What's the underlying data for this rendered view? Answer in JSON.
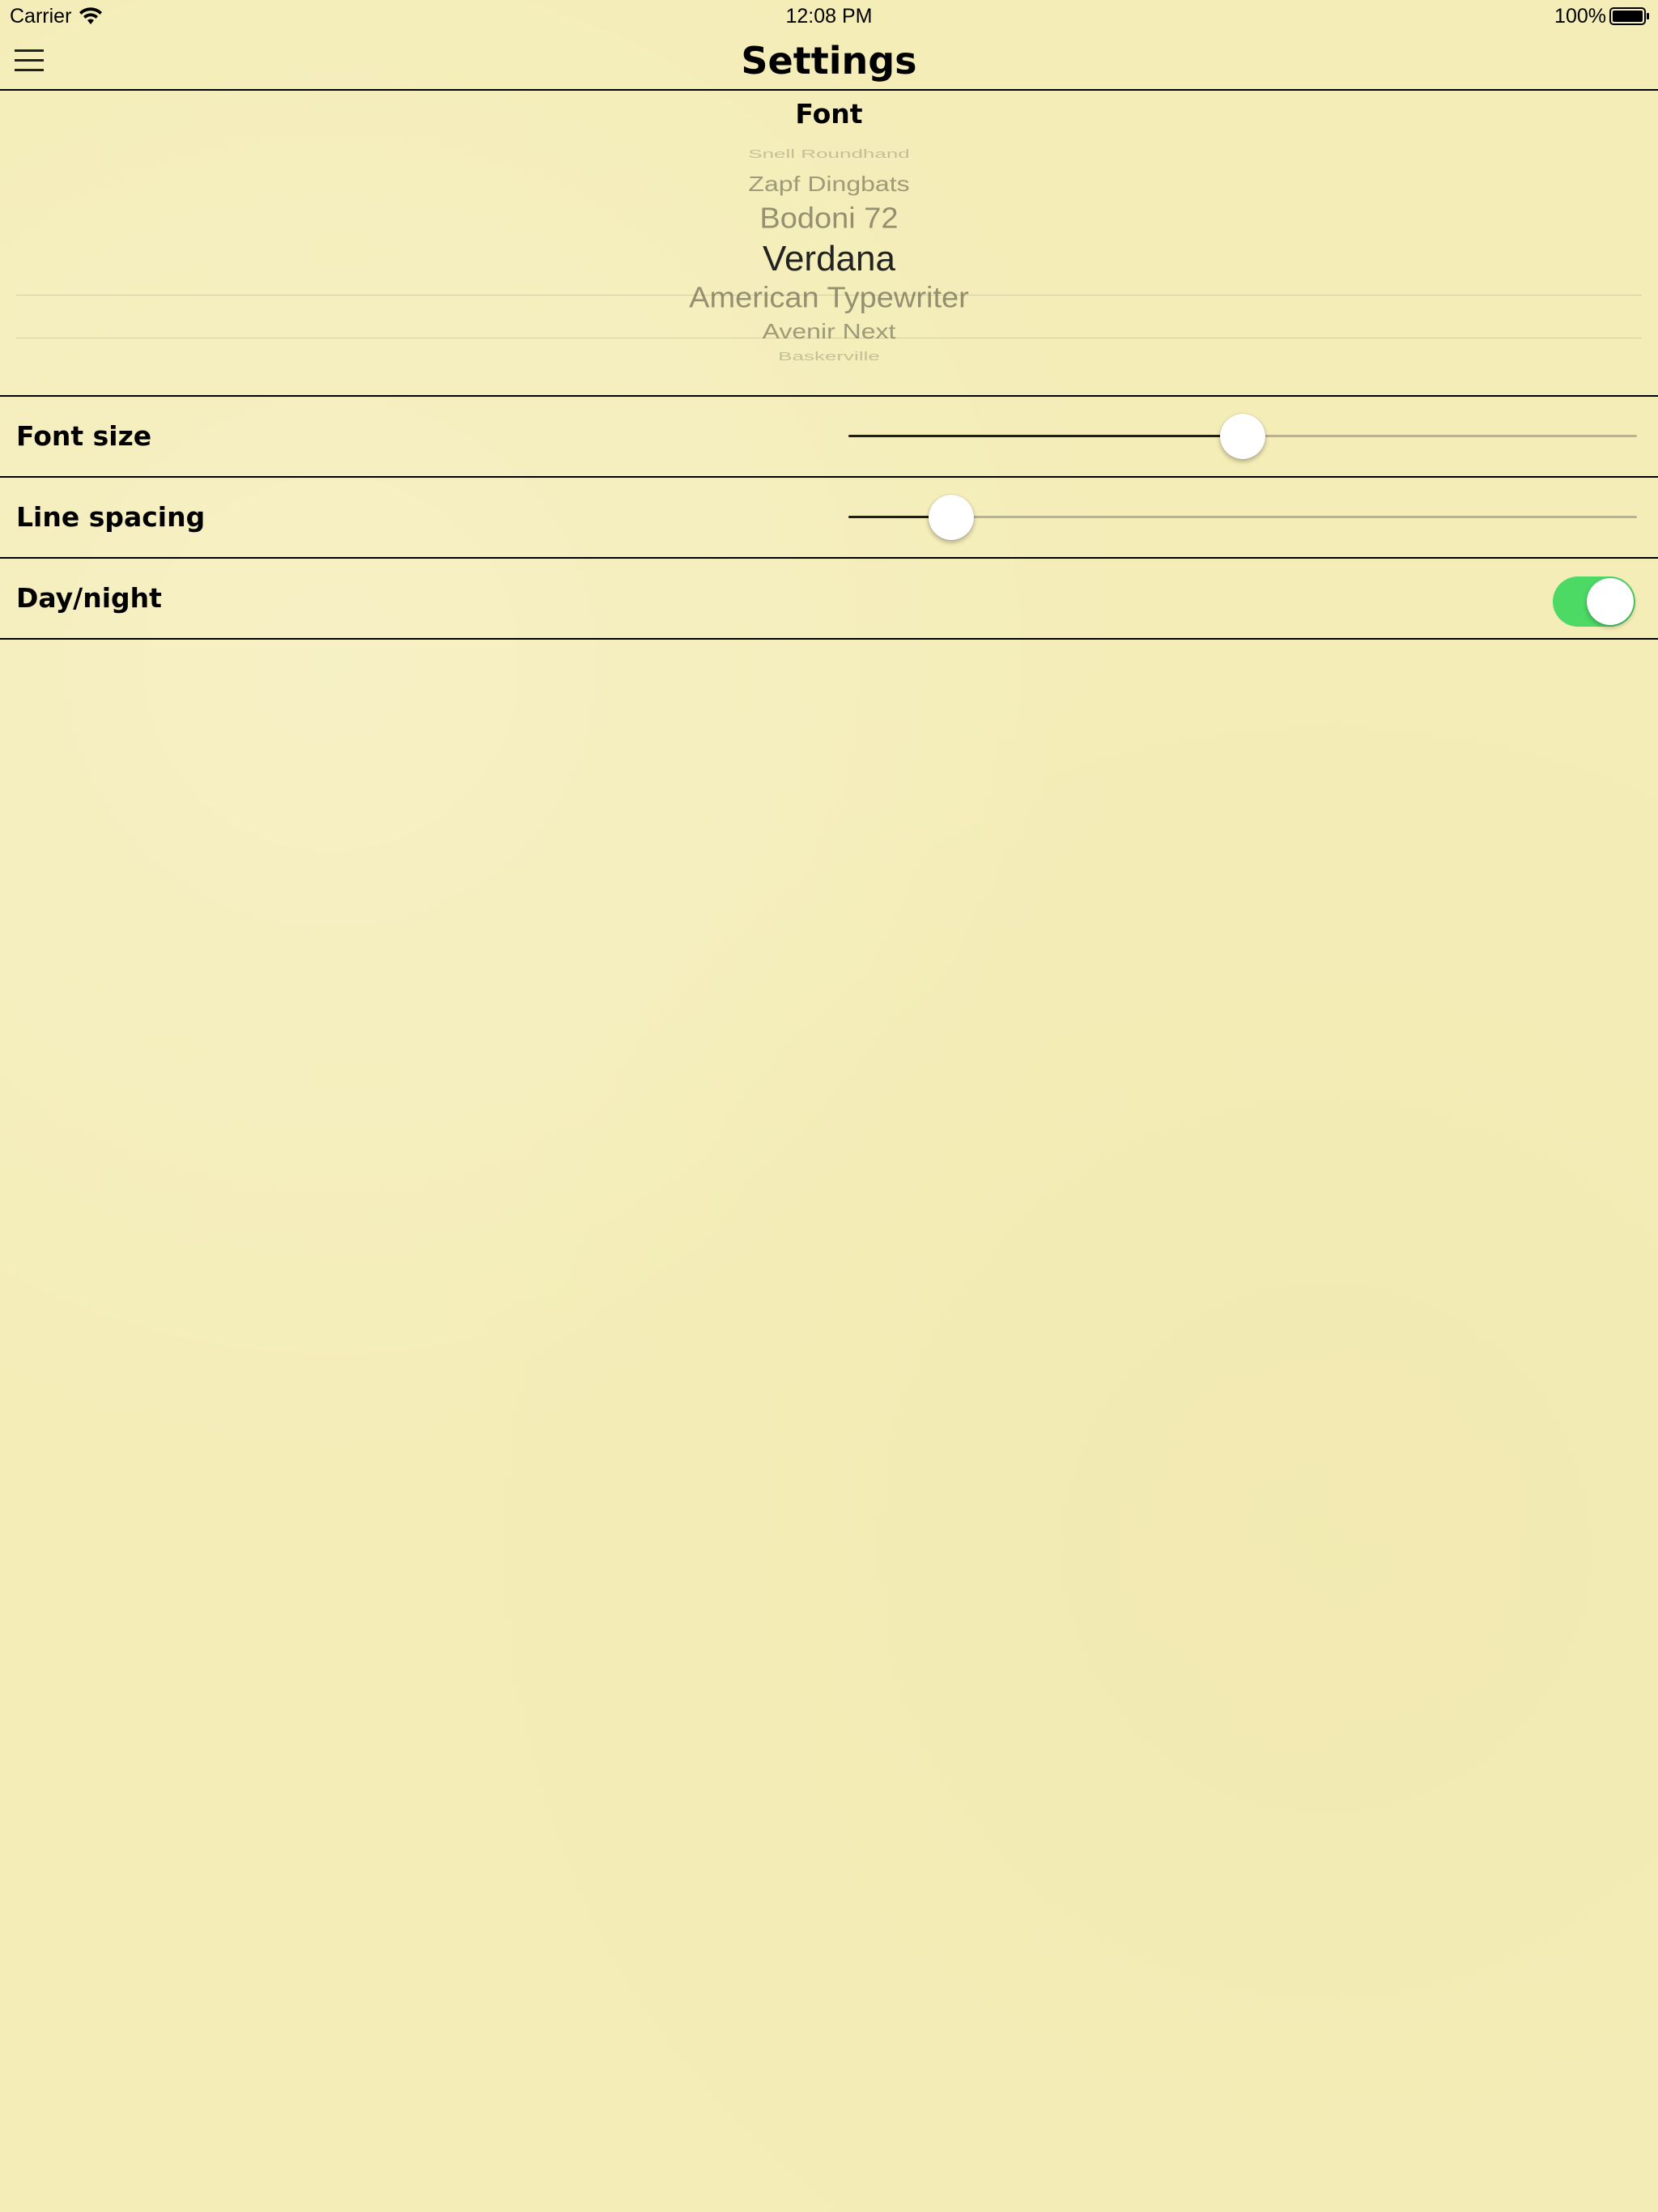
{
  "status_bar": {
    "carrier": "Carrier",
    "time": "12:08 PM",
    "battery": "100%",
    "battery_level": 1.0
  },
  "nav": {
    "title": "Settings",
    "menu_icon": "hamburger-menu-icon"
  },
  "font_section": {
    "heading": "Font",
    "picker": {
      "items": [
        "Snell Roundhand",
        "Zapf Dingbats",
        "Bodoni 72",
        "Verdana",
        "American Typewriter",
        "Avenir Next",
        "Baskerville"
      ],
      "selected": "Verdana"
    }
  },
  "settings": {
    "font_size": {
      "label": "Font size",
      "value": 0.5
    },
    "line_spacing": {
      "label": "Line spacing",
      "value": 0.13
    },
    "day_night": {
      "label": "Day/night",
      "on": true
    }
  },
  "colors": {
    "background": "#f4edb8",
    "toggle_on": "#4cd964",
    "slider_fill": "#1c1c1c",
    "slider_track": "#b5b19a"
  }
}
